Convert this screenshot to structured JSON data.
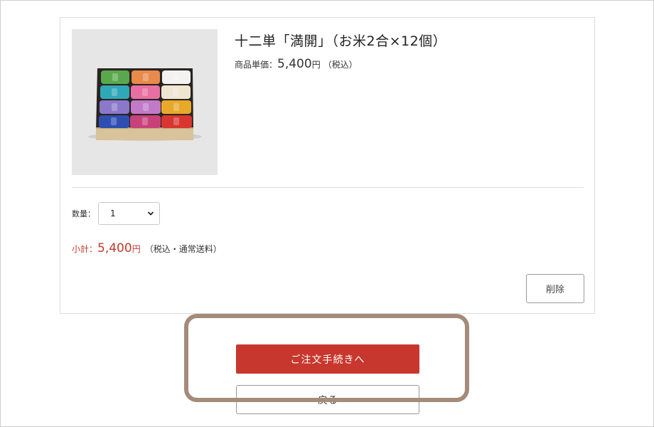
{
  "product": {
    "name": "十二単「満開」（お米2合×12個）",
    "price_label": "商品単価：",
    "price_value": "5,400",
    "price_currency": "円",
    "price_tax_note": "（税込）"
  },
  "quantity": {
    "label": "数量：",
    "selected": "1"
  },
  "subtotal": {
    "label": "小計：",
    "value": "5,400",
    "currency": "円",
    "note": "（税込・通常送料）"
  },
  "buttons": {
    "delete": "削除",
    "checkout": "ご注文手続きへ",
    "back": "戻る"
  },
  "colors": {
    "accent": "#c8372d",
    "subtotal_text": "#c0392b",
    "highlight": "#a58b7a"
  }
}
